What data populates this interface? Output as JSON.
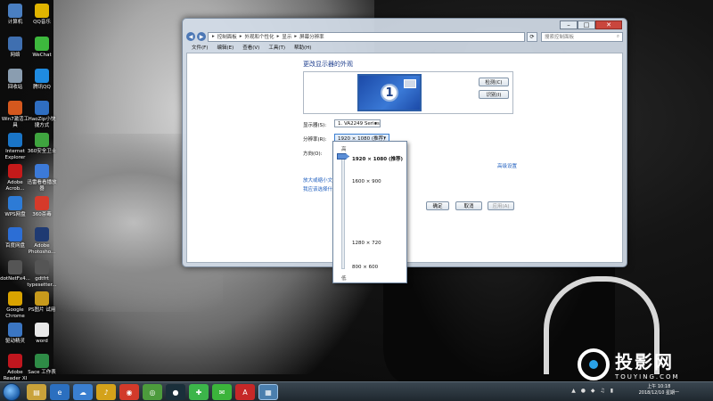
{
  "desktop": {
    "icons": [
      {
        "label": "计算机",
        "color": "#4a7fc1"
      },
      {
        "label": "QQ音乐",
        "color": "#e0b400"
      },
      {
        "label": "网络",
        "color": "#3f6fb0"
      },
      {
        "label": "WeChat",
        "color": "#3db83d"
      },
      {
        "label": "回收站",
        "color": "#8a9db0"
      },
      {
        "label": "腾讯QQ",
        "color": "#1f8be0"
      },
      {
        "label": "Win7激活工具",
        "color": "#d5581e"
      },
      {
        "label": "HaoZip小快捷方式",
        "color": "#2f6ec1"
      },
      {
        "label": "Internet Explorer",
        "color": "#1a75c7"
      },
      {
        "label": "360安全卫士",
        "color": "#3fa43f"
      },
      {
        "label": "Adobe Acrob...",
        "color": "#c41a1a"
      },
      {
        "label": "迅雷看看播放器",
        "color": "#3c7ad8"
      },
      {
        "label": "WPS网盘",
        "color": "#2d7bd6"
      },
      {
        "label": "360杀毒",
        "color": "#d63a2a"
      },
      {
        "label": "百度网盘",
        "color": "#2c6ed5"
      },
      {
        "label": "Adobe Photosho...",
        "color": "#1f3a72"
      },
      {
        "label": "dotNetFx4...",
        "color": "#555"
      },
      {
        "label": "gdtfrt typesetter...",
        "color": "#555"
      },
      {
        "label": "Google Chrome",
        "color": "#d9a300"
      },
      {
        "label": "PS图片 试用",
        "color": "#c79a1c"
      },
      {
        "label": "驱动精灵",
        "color": "#3b76c3"
      },
      {
        "label": "word",
        "color": "#e8e8e8"
      },
      {
        "label": "Adobe Reader XI",
        "color": "#c0161e"
      },
      {
        "label": "Sace 工作表",
        "color": "#2e8b46"
      }
    ]
  },
  "window": {
    "address_path": [
      "控制面板",
      "外观和个性化",
      "显示",
      "屏幕分辨率"
    ],
    "search_placeholder": "搜索控制面板",
    "menu": [
      "文件(F)",
      "编辑(E)",
      "查看(V)",
      "工具(T)",
      "帮助(H)"
    ],
    "content": {
      "title": "更改显示器的外观",
      "monitor_number": "1",
      "detect_btn": "检测(C)",
      "identify_btn": "识别(I)",
      "display_label": "显示器(S):",
      "display_value": "1. VA2249 Series",
      "resolution_label": "分辨率(R):",
      "resolution_value": "1920 × 1080 (推荐)",
      "orientation_label": "方向(O):",
      "advanced_link": "高级设置",
      "link1": "放大或缩小文本",
      "link2": "我应该选择什么",
      "ok_btn": "确定",
      "cancel_btn": "取消",
      "apply_btn": "应用(A)"
    },
    "dropdown": {
      "high": "高",
      "low": "低",
      "options": [
        "1920 × 1080 (推荐)",
        "1600 × 900",
        "1280 × 720",
        "800 × 600"
      ]
    }
  },
  "taskbar": {
    "tray_time": "10:18",
    "tray_date": "2018/12/10 星期一",
    "tray_ampm": "上午"
  },
  "watermark": {
    "name": "投影网",
    "url": "TOUYING.COM"
  }
}
